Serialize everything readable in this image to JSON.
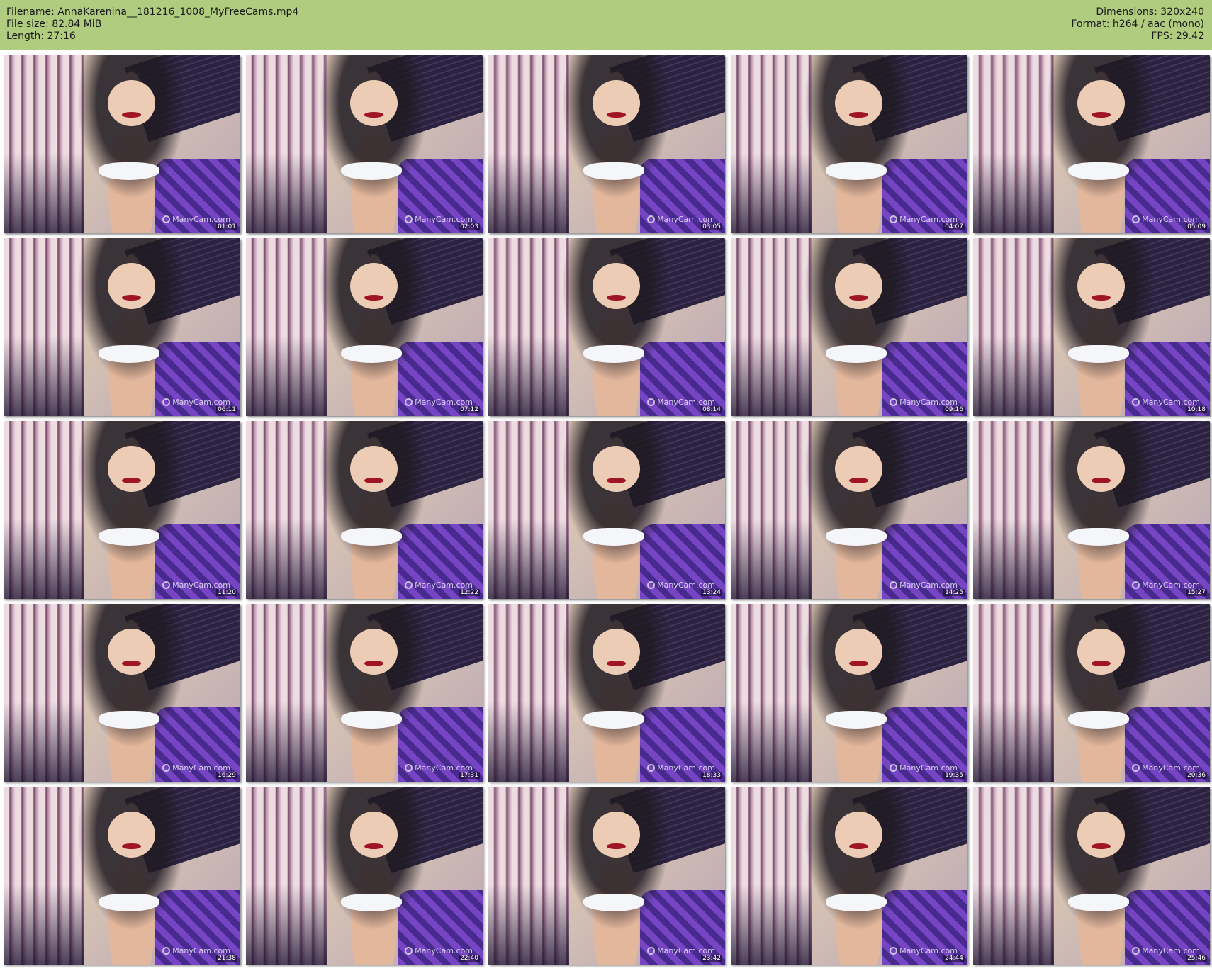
{
  "header": {
    "filename": "Filename: AnnaKarenina__181216_1008_MyFreeCams.mp4",
    "file_size": "File size: 82.84 MiB",
    "length": "Length: 27:16",
    "dimensions": "Dimensions: 320x240",
    "format": "Format: h264 / aac (mono)",
    "fps": "FPS: 29.42"
  },
  "watermark_text": "ManyCam.com",
  "thumbnails": [
    {
      "time": "01:01"
    },
    {
      "time": "02:03"
    },
    {
      "time": "03:05"
    },
    {
      "time": "04:07"
    },
    {
      "time": "05:09"
    },
    {
      "time": "06:11"
    },
    {
      "time": "07:12"
    },
    {
      "time": "08:14"
    },
    {
      "time": "09:16"
    },
    {
      "time": "10:18"
    },
    {
      "time": "11:20"
    },
    {
      "time": "12:22"
    },
    {
      "time": "13:24"
    },
    {
      "time": "14:25"
    },
    {
      "time": "15:27"
    },
    {
      "time": "16:29"
    },
    {
      "time": "17:31"
    },
    {
      "time": "18:33"
    },
    {
      "time": "19:35"
    },
    {
      "time": "20:36"
    },
    {
      "time": "21:38"
    },
    {
      "time": "22:40"
    },
    {
      "time": "23:42"
    },
    {
      "time": "24:44"
    },
    {
      "time": "25:46"
    }
  ],
  "colors": {
    "header_background": "#b0cc7f"
  }
}
